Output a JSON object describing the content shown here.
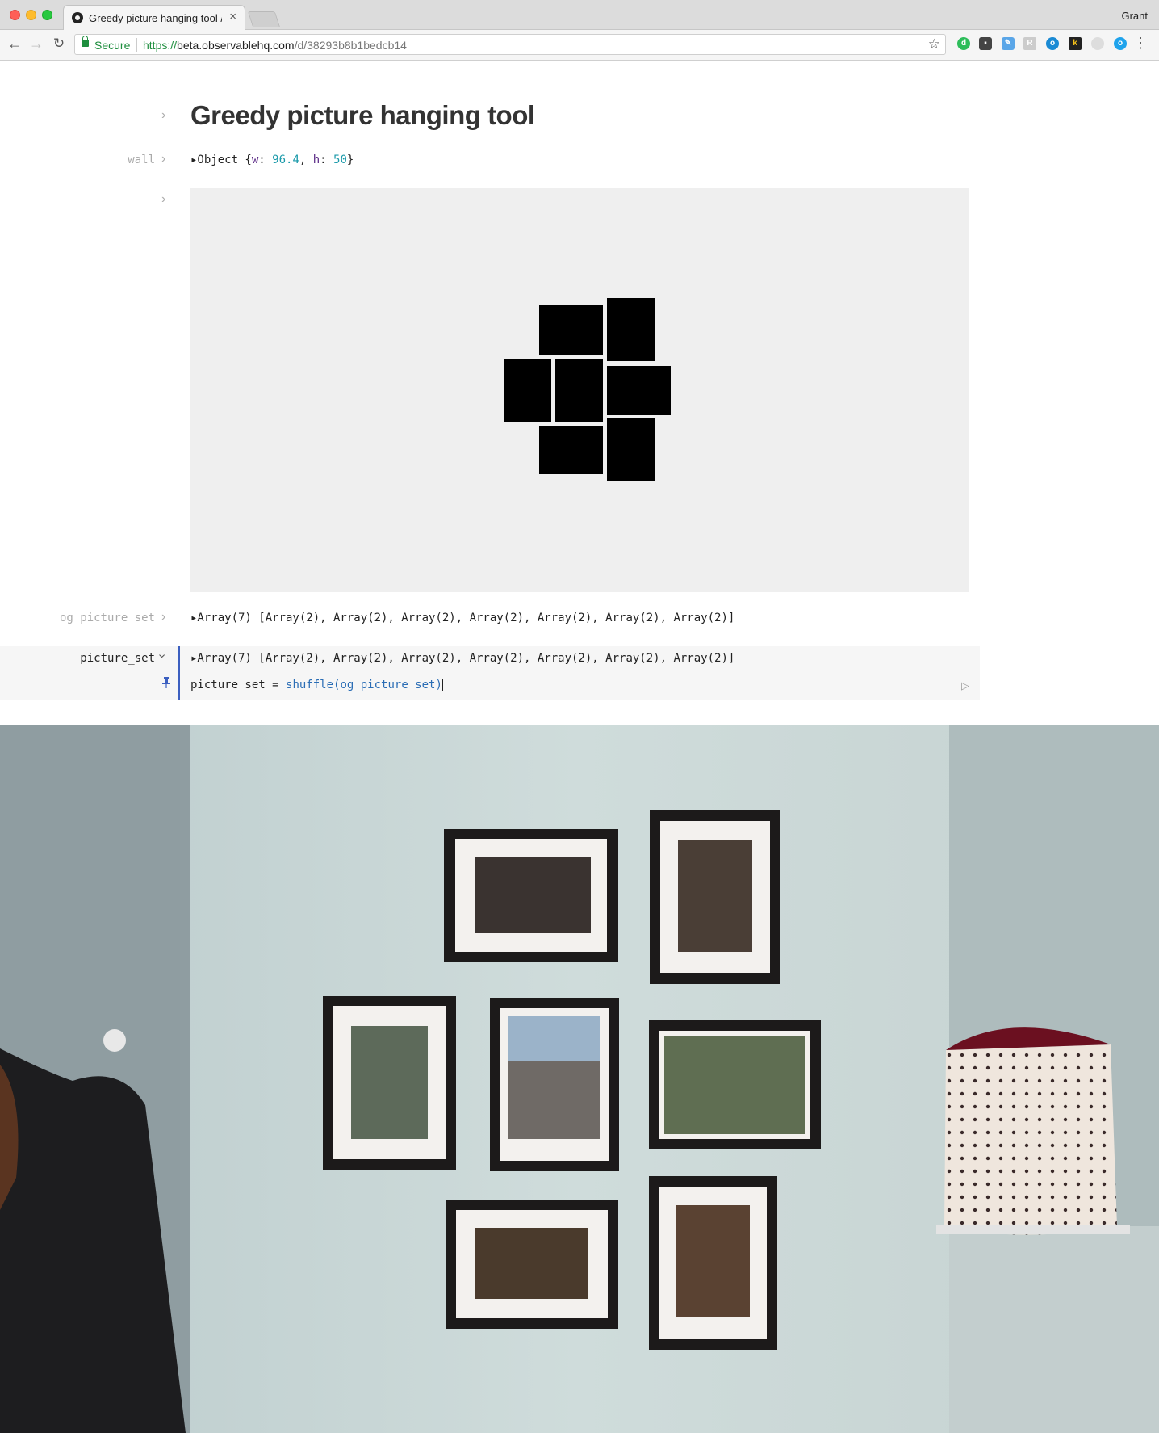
{
  "browser": {
    "tab_title": "Greedy picture hanging tool / Ob",
    "profile_name": "Grant",
    "secure_label": "Secure",
    "url_scheme": "https://",
    "url_host": "beta.observablehq.com",
    "url_path": "/d/38293b8b1bedcb14"
  },
  "notebook": {
    "title": "Greedy picture hanging tool",
    "cells": {
      "wall": {
        "name": "wall",
        "prefix": "▸Object {",
        "w_key": "w",
        "w_value": "96.4",
        "h_key": "h",
        "h_value": "50",
        "suffix": "}"
      },
      "og_picture_set": {
        "name": "og_picture_set",
        "value": "▸Array(7) [Array(2), Array(2), Array(2), Array(2), Array(2), Array(2), Array(2)]"
      },
      "picture_set": {
        "name": "picture_set",
        "value": "▸Array(7) [Array(2), Array(2), Array(2), Array(2), Array(2), Array(2), Array(2)]",
        "code_lhs": "picture_set = ",
        "code_fn": "shuffle",
        "code_args": "(og_picture_set)"
      }
    }
  },
  "colors": {
    "canvas_bg": "#efefef",
    "picture_fill": "#000000",
    "accent": "#3b5fc0"
  }
}
